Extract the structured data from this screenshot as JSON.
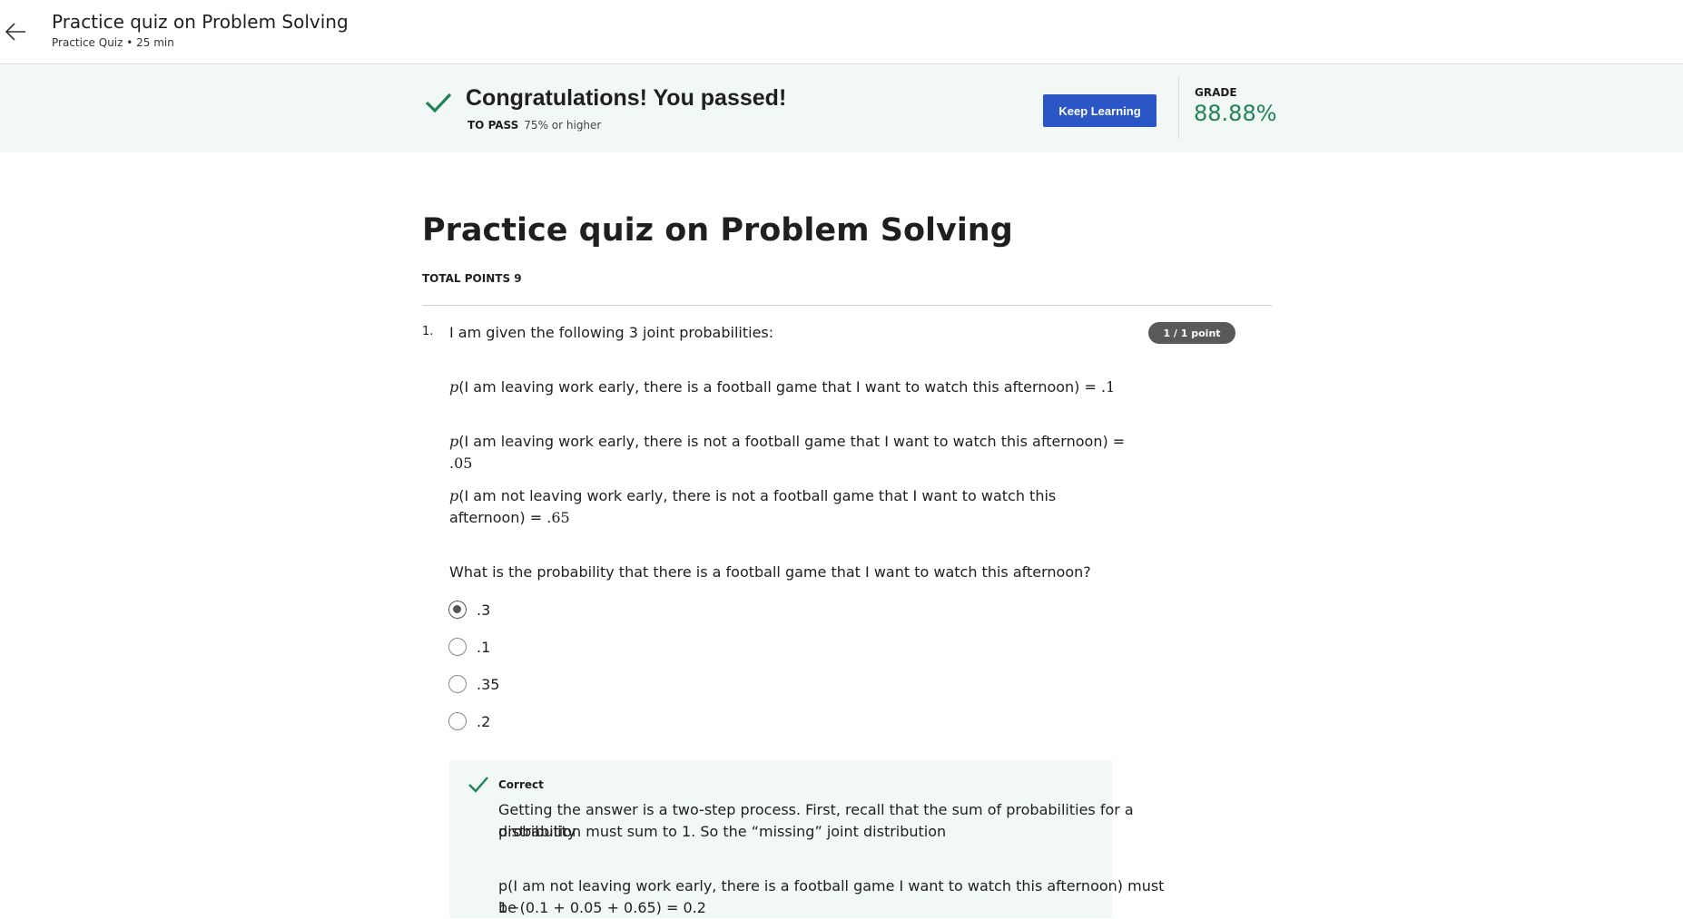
{
  "header": {
    "title": "Practice quiz on Problem Solving",
    "subtitle": "Practice Quiz • 25 min"
  },
  "banner": {
    "heading": "Congratulations! You passed!",
    "to_pass_label": "TO PASS",
    "to_pass_value": "75% or higher",
    "keep_learning": "Keep Learning",
    "grade_label": "GRADE",
    "grade_value": "88.88%",
    "accent_color": "#1f8354",
    "button_color": "#2a56c6"
  },
  "quiz": {
    "title": "Practice quiz on Problem Solving",
    "total_points": "TOTAL POINTS 9"
  },
  "question": {
    "number": "1.",
    "points": "1 / 1 point",
    "intro": "I am given the following 3 joint probabilities:",
    "probs": [
      {
        "p": "p",
        "text": "(I am leaving work early, there is a football game that I want to watch this afternoon) = ",
        "value": ".1"
      },
      {
        "p": "p",
        "text": "(I am leaving work early, there is not a football game that I want to watch this afternoon) = ",
        "value": ".05"
      },
      {
        "p": "p",
        "text": "(I am not leaving work early, there is not a football game that I want to watch this afternoon) = ",
        "value": ".65"
      }
    ],
    "prompt": "What is the probability that there is a football game that I want to watch this afternoon?",
    "options": [
      {
        "label": ".3",
        "selected": true
      },
      {
        "label": ".1",
        "selected": false
      },
      {
        "label": ".35",
        "selected": false
      },
      {
        "label": ".2",
        "selected": false
      }
    ]
  },
  "feedback": {
    "label": "Correct",
    "text1_line1": "Getting the answer is a two-step process. First, recall that the sum of probabilities for a probability",
    "text1_line2": "distribution must sum to 1. So the “missing” joint distribution",
    "text2_line1": "p(I am not leaving work early, there is a football game I want to watch this afternoon) must be",
    "text2_line2": "1−(0.1 + 0.05 + 0.65) = 0.2"
  }
}
